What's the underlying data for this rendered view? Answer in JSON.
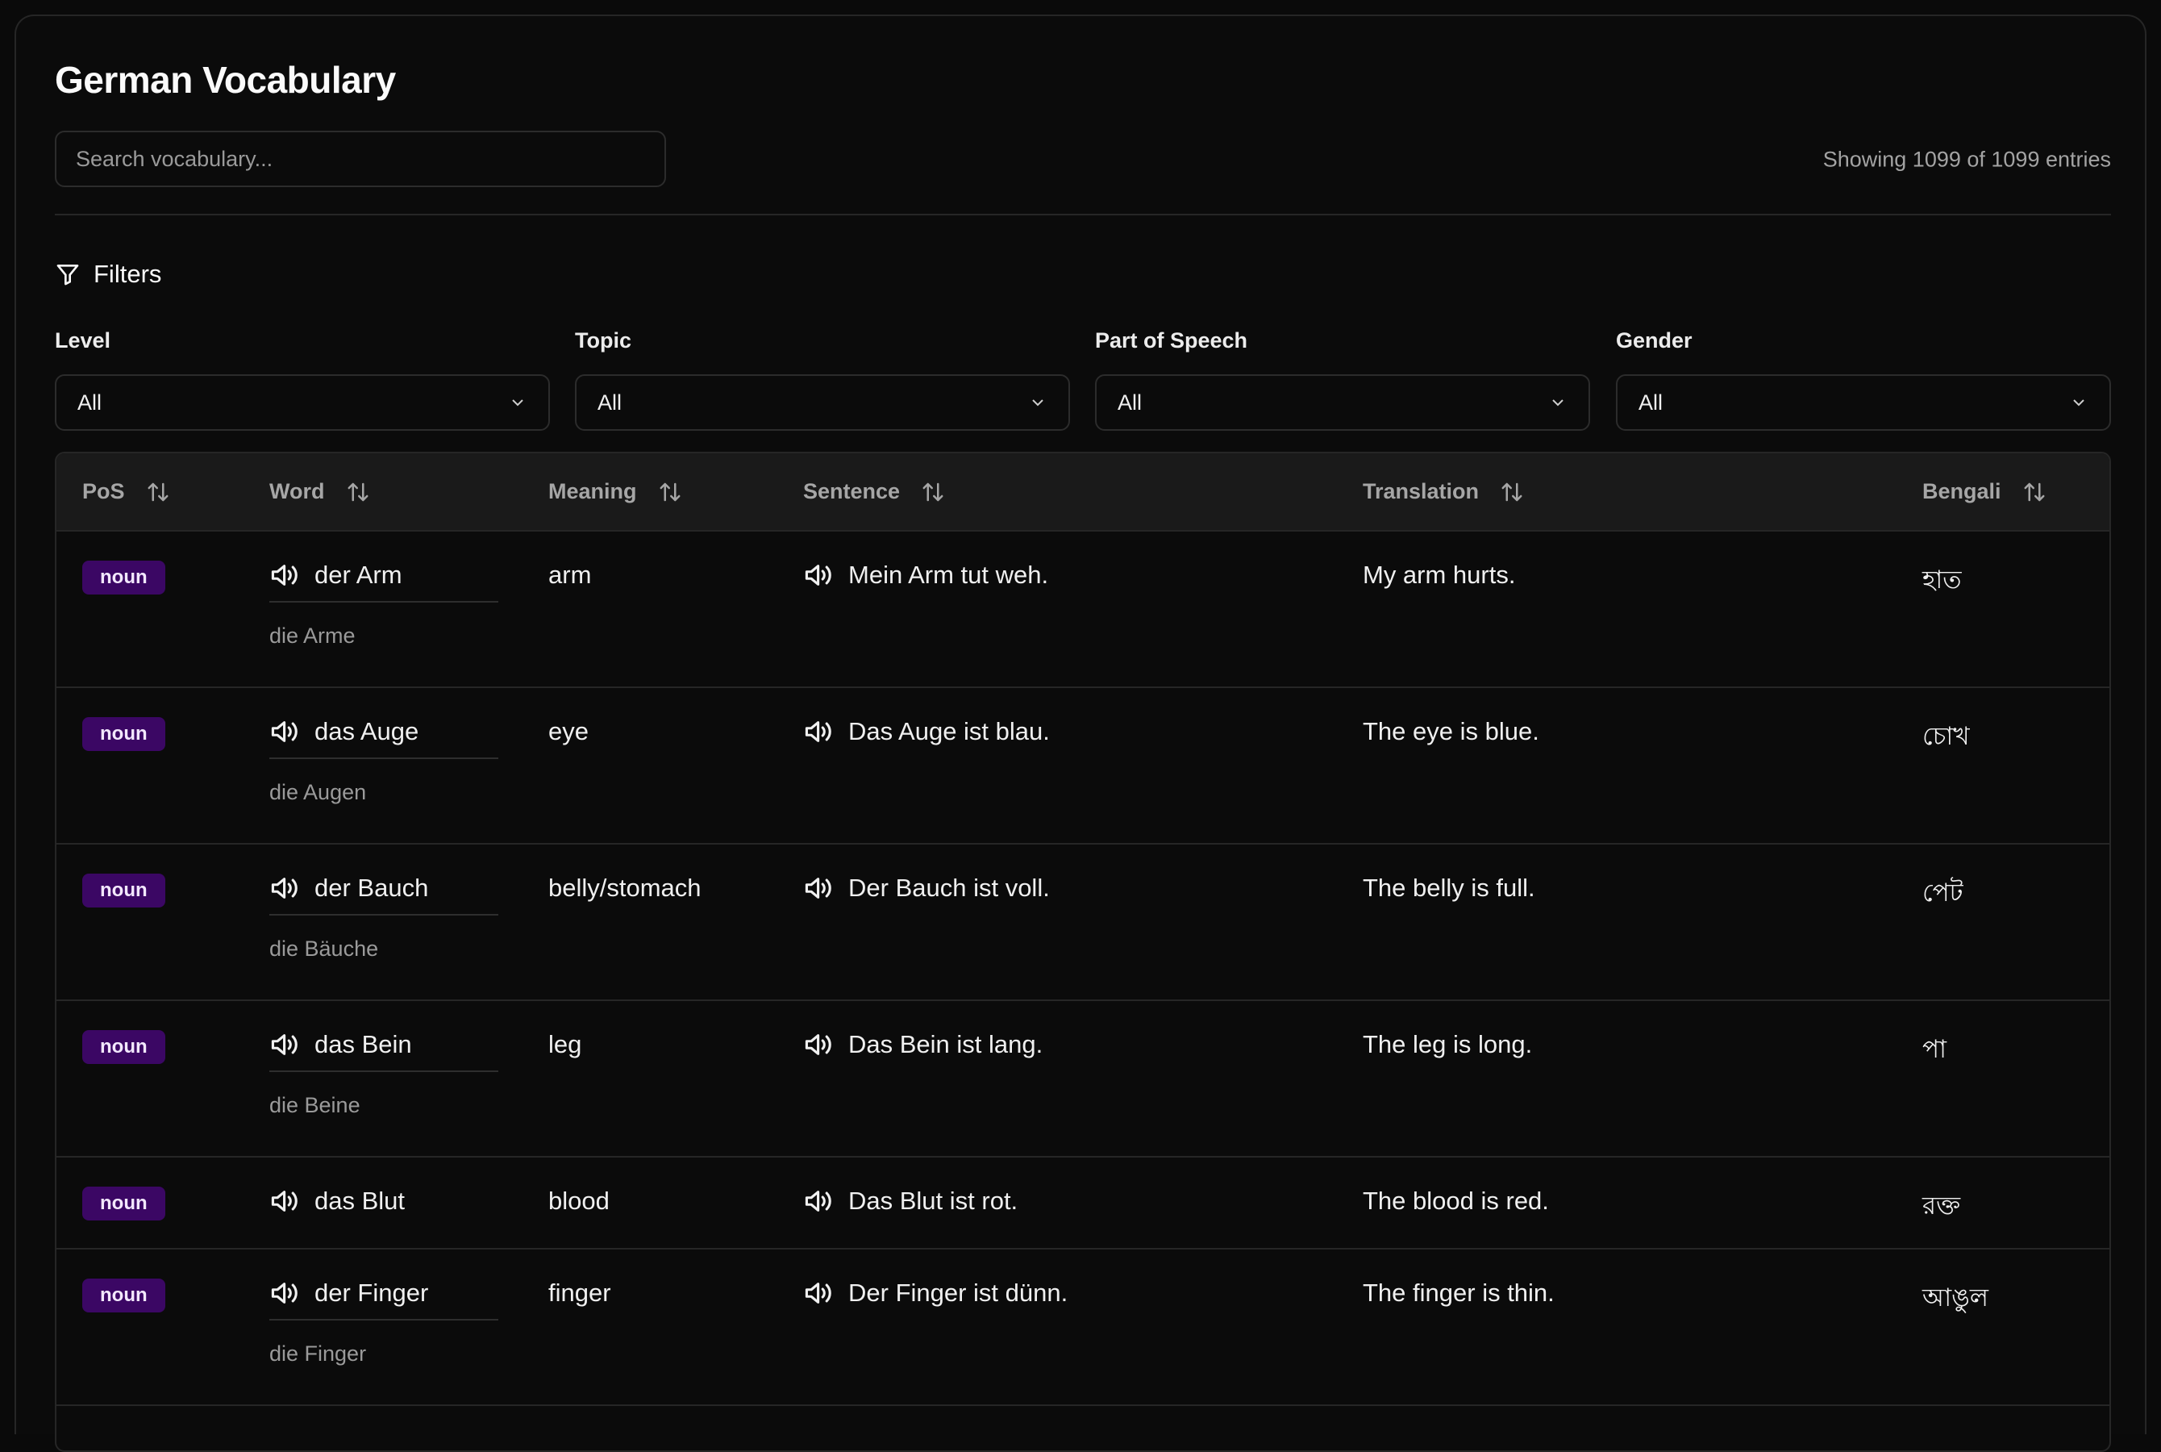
{
  "header": {
    "title": "German Vocabulary",
    "search_placeholder": "Search vocabulary...",
    "count_text": "Showing 1099 of 1099 entries"
  },
  "filters": {
    "heading": "Filters",
    "groups": [
      {
        "label": "Level",
        "value": "All"
      },
      {
        "label": "Topic",
        "value": "All"
      },
      {
        "label": "Part of Speech",
        "value": "All"
      },
      {
        "label": "Gender",
        "value": "All"
      }
    ]
  },
  "table": {
    "columns": [
      "PoS",
      "Word",
      "Meaning",
      "Sentence",
      "Translation",
      "Bengali"
    ],
    "rows": [
      {
        "pos": "noun",
        "word": "der Arm",
        "plural": "die Arme",
        "meaning": "arm",
        "sentence": "Mein Arm tut weh.",
        "translation": "My arm hurts.",
        "bengali": "হাত"
      },
      {
        "pos": "noun",
        "word": "das Auge",
        "plural": "die Augen",
        "meaning": "eye",
        "sentence": "Das Auge ist blau.",
        "translation": "The eye is blue.",
        "bengali": "চোখ"
      },
      {
        "pos": "noun",
        "word": "der Bauch",
        "plural": "die Bäuche",
        "meaning": "belly/stomach",
        "sentence": "Der Bauch ist voll.",
        "translation": "The belly is full.",
        "bengali": "পেট"
      },
      {
        "pos": "noun",
        "word": "das Bein",
        "plural": "die Beine",
        "meaning": "leg",
        "sentence": "Das Bein ist lang.",
        "translation": "The leg is long.",
        "bengali": "পা"
      },
      {
        "pos": "noun",
        "word": "das Blut",
        "plural": "",
        "meaning": "blood",
        "sentence": "Das Blut ist rot.",
        "translation": "The blood is red.",
        "bengali": "রক্ত"
      },
      {
        "pos": "noun",
        "word": "der Finger",
        "plural": "die Finger",
        "meaning": "finger",
        "sentence": "Der Finger ist dünn.",
        "translation": "The finger is thin.",
        "bengali": "আঙুল"
      }
    ]
  },
  "icons": {
    "filter": "filter-icon",
    "sort": "sort-arrows-icon",
    "speaker": "speaker-icon",
    "chevron": "chevron-down-icon"
  },
  "colors": {
    "background": "#0b0b0b",
    "badge_bg": "#3b0764",
    "badge_text": "#f3e8ff"
  }
}
